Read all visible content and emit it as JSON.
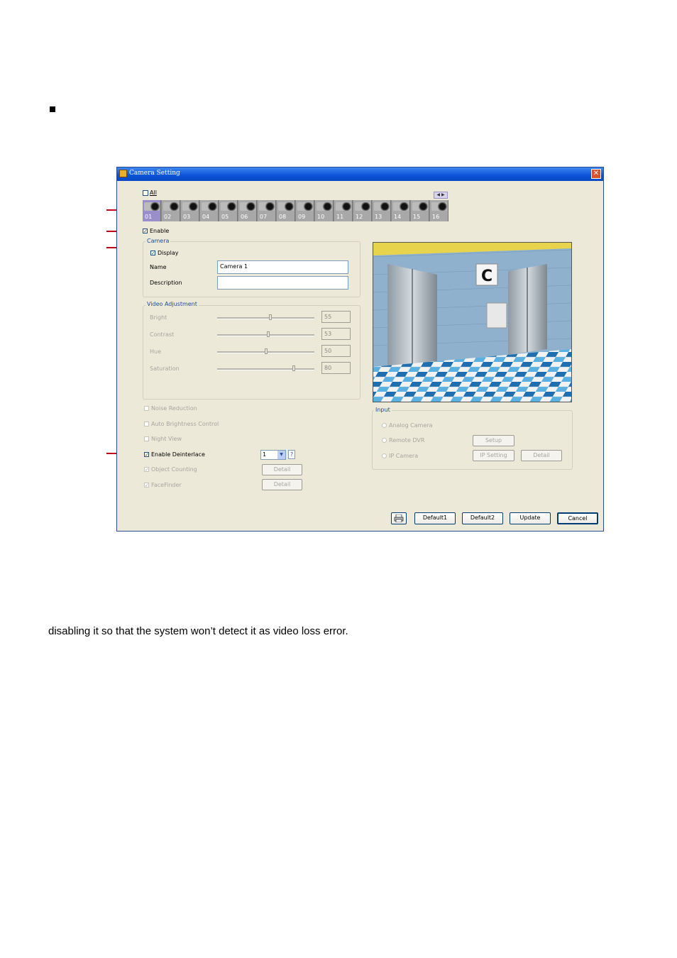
{
  "doc": {
    "bottom_text": "disabling it so that the system won’t detect it as video loss error."
  },
  "window": {
    "title": "Camera Setting",
    "close_glyph": "✕"
  },
  "cameras": {
    "all_label": "All",
    "items": [
      "01",
      "02",
      "03",
      "04",
      "05",
      "06",
      "07",
      "08",
      "09",
      "10",
      "11",
      "12",
      "13",
      "14",
      "15",
      "16"
    ],
    "nav_arrows": "◀ ▶"
  },
  "enable_label": "Enable",
  "camera_group": {
    "title": "Camera",
    "display_label": "Display",
    "name_label": "Name",
    "name_value": "Camera 1",
    "description_label": "Description",
    "description_value": ""
  },
  "video_adjustment": {
    "title": "Video Adjustment",
    "rows": [
      {
        "label": "Bright",
        "value": "55",
        "level": 55
      },
      {
        "label": "Contrast",
        "value": "53",
        "level": 53
      },
      {
        "label": "Hue",
        "value": "50",
        "level": 50
      },
      {
        "label": "Saturation",
        "value": "80",
        "level": 80
      }
    ]
  },
  "options": {
    "noise_reduction": "Noise Reduction",
    "auto_brightness": "Auto Brightness Control",
    "night_view": "Night View",
    "enable_deinterlace": "Enable Deinterlace",
    "deinterlace_value": "1",
    "help_glyph": "?",
    "object_counting": "Object Counting",
    "facefinder": "FaceFinder",
    "detail": "Detail"
  },
  "input_group": {
    "title": "Input",
    "analog": "Analog Camera",
    "remote": "Remote DVR",
    "ip": "IP Camera",
    "setup": "Setup",
    "ip_setting": "IP Setting",
    "detail": "Detail"
  },
  "footer": {
    "default1": "Default1",
    "default2": "Default2",
    "update": "Update",
    "cancel": "Cancel"
  },
  "colors": {
    "titlebar": "#0a52d8",
    "callout": "#c00018",
    "selected_camera": "#9a8fca"
  }
}
